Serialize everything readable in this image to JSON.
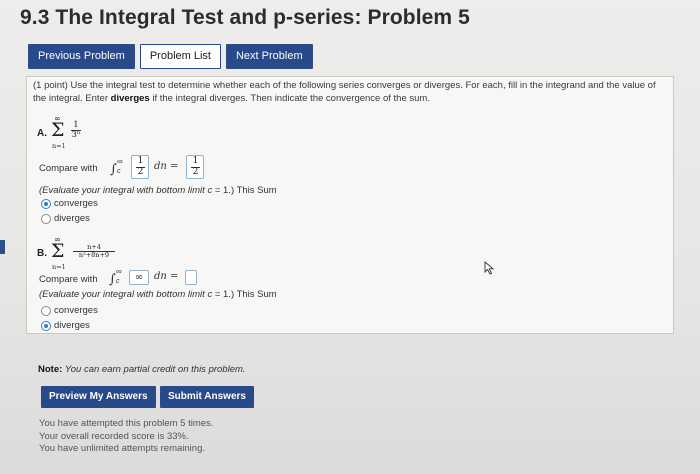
{
  "page": {
    "title": "9.3 The Integral Test and p-series: Problem 5"
  },
  "nav": {
    "previous": "Previous Problem",
    "list": "Problem List",
    "next": "Next Problem"
  },
  "intro": {
    "part1": "(1 point) Use the integral test to determine whether each of the following series converges or diverges. For each, fill in the integrand and the value of the integral. Enter",
    "bold": "diverges",
    "part2": "if the integral diverges. Then indicate the convergence of the sum."
  },
  "partA": {
    "label": "A.",
    "sum_upper": "∞",
    "sum_lower": "n=1",
    "term_num": "1",
    "term_den": "3ⁿ",
    "compare_label": "Compare with",
    "integral_upper": "∞",
    "integral_lower": "c",
    "integrand_num": "1",
    "integrand_den": "2",
    "dn": "dn =",
    "value_num": "1",
    "value_den": "2",
    "evaluate_text": "(Evaluate your integral with bottom limit",
    "evaluate_c": "c",
    "evaluate_eq": "= 1.) This Sum",
    "options": [
      "converges",
      "diverges"
    ],
    "selected": "converges"
  },
  "partB": {
    "label": "B.",
    "sum_upper": "∞",
    "sum_lower": "n=1",
    "term_num": "n+4",
    "term_den": "n²+8n+9",
    "compare_label": "Compare with",
    "integral_upper": "∞",
    "integral_lower": "c",
    "integrand": "∞",
    "dn": "dn =",
    "value": "",
    "evaluate_text": "(Evaluate your integral with bottom limit",
    "evaluate_c": "c",
    "evaluate_eq": "= 1.) This Sum",
    "options": [
      "converges",
      "diverges"
    ],
    "selected": "diverges"
  },
  "note": {
    "label": "Note:",
    "text": "You can earn partial credit on this problem."
  },
  "actions": {
    "preview": "Preview My Answers",
    "submit": "Submit Answers"
  },
  "status": {
    "line1": "You have attempted this problem 5 times.",
    "line2": "Your overall recorded score is 33%.",
    "line3": "You have unlimited attempts remaining."
  },
  "colors": {
    "button_bg": "#28498a",
    "radio_selected": "#2f7bd0",
    "answer_border": "#8fb4cf"
  }
}
